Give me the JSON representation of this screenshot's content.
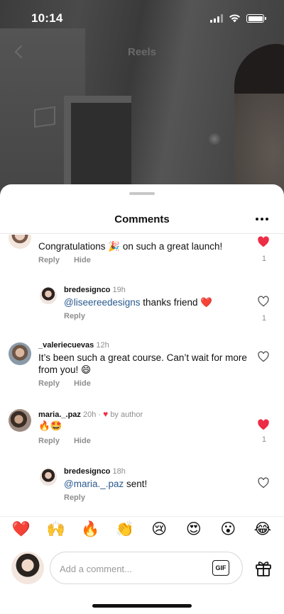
{
  "status_bar": {
    "time": "10:14"
  },
  "reels_header": {
    "title": "Reels"
  },
  "sheet": {
    "title": "Comments"
  },
  "comments": [
    {
      "text_a": "Congratulations ",
      "emoji": "🎉",
      "text_b": " on such a great launch!",
      "reply": "Reply",
      "hide": "Hide",
      "liked": true,
      "like_count": "1"
    },
    {
      "username": "bredesignco",
      "time": "19h",
      "mention": "@liseereedesigns",
      "text": " thanks friend ",
      "emoji": "❤️",
      "reply": "Reply",
      "liked": false,
      "like_count": "1"
    },
    {
      "username": "_valeriecuevas",
      "time": "12h",
      "text": "It’s been such a great course. Can’t wait for more from you! ",
      "emoji": "😄",
      "reply": "Reply",
      "hide": "Hide",
      "liked": false
    },
    {
      "username": "maria._.paz",
      "time": "20h",
      "by_author": "by author",
      "emoji": "🔥🤩",
      "reply": "Reply",
      "hide": "Hide",
      "liked": true,
      "like_count": "1"
    },
    {
      "username": "bredesignco",
      "time": "18h",
      "mention": "@maria._.paz",
      "text": " sent!",
      "reply": "Reply",
      "liked": false
    }
  ],
  "reactions": [
    "❤️",
    "🙌",
    "🔥",
    "👏",
    "😢",
    "😍",
    "😮",
    "😂"
  ],
  "composer": {
    "placeholder": "Add a comment...",
    "gif_label": "GIF"
  },
  "colors": {
    "like_red": "#ed2d45",
    "mention_blue": "#2a5a8f"
  }
}
